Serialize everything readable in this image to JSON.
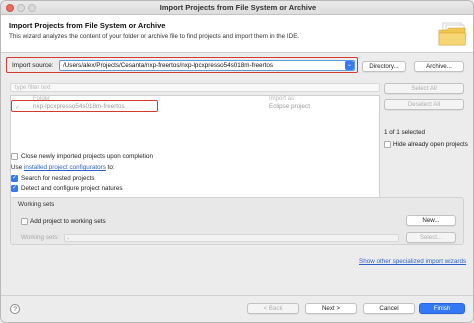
{
  "window": {
    "title": "Import Projects from File System or Archive"
  },
  "header": {
    "title": "Import Projects from File System or Archive",
    "description": "This wizard analyzes the content of your folder or archive file to find projects and import them in the IDE.",
    "icon": "folder-icon"
  },
  "import_source": {
    "label": "Import source:",
    "value": "/Users/alex/Projects/Cesanta/nxp-freertos/nxp-lpcxpresso54s018m-freertos",
    "directory_button": "Directory...",
    "archive_button": "Archive..."
  },
  "filter": {
    "placeholder": "type filter text"
  },
  "table": {
    "columns": [
      "Folder",
      "Import as"
    ],
    "rows": [
      {
        "checked": true,
        "folder": "nxp-lpcxpresso54s018m-freertos",
        "import_as": "Eclipse project"
      }
    ]
  },
  "buttons": {
    "select_all": "Select All",
    "deselect_all": "Deselect All",
    "back": "< Back",
    "next": "Next >",
    "cancel": "Cancel",
    "finish": "Finish",
    "new": "New...",
    "select": "Select..."
  },
  "selection": {
    "count_text": "1 of 1 selected",
    "hide_open_label": "Hide already open projects"
  },
  "options": {
    "close_newly_label": "Close newly imported projects upon completion",
    "use_prefix": "Use ",
    "configurators_link": "installed project configurators",
    "use_suffix": " to:",
    "search_nested_label": "Search for nested projects",
    "detect_natures_label": "Detect and configure project natures"
  },
  "working_sets": {
    "group_title": "Working sets",
    "add_label": "Add project to working sets",
    "field_label": "Working sets:"
  },
  "footer": {
    "specialized_link": "Show other specialized import wizards"
  },
  "colors": {
    "accent": "#3478f6",
    "highlight": "#d33b2c",
    "link": "#2d63c8"
  }
}
